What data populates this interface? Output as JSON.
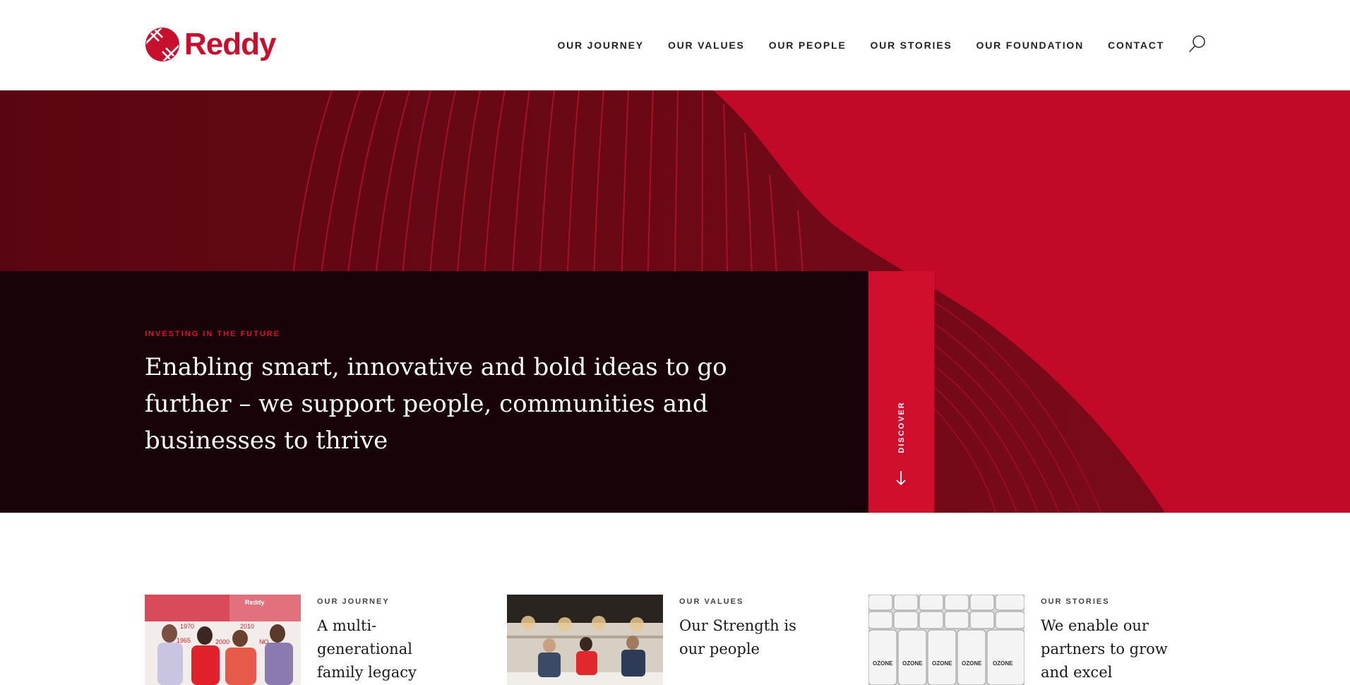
{
  "brand": {
    "name": "Reddy",
    "color": "#c8102e"
  },
  "nav": {
    "items": [
      {
        "label": "OUR JOURNEY"
      },
      {
        "label": "OUR VALUES"
      },
      {
        "label": "OUR PEOPLE"
      },
      {
        "label": "OUR STORIES"
      },
      {
        "label": "OUR FOUNDATION"
      },
      {
        "label": "CONTACT"
      }
    ],
    "search_icon": "search-icon"
  },
  "hero": {
    "kicker": "INVESTING IN THE FUTURE",
    "title": "Enabling smart, innovative and bold ideas to go further – we support people, communities and businesses to thrive",
    "discover_label": "DISCOVER",
    "colors": {
      "red": "#c20a28",
      "dark": "#170308",
      "accent": "#d00f2c"
    }
  },
  "cards": [
    {
      "kicker": "OUR JOURNEY",
      "title": "A multi-generational family legacy",
      "image": "family-photo"
    },
    {
      "kicker": "OUR VALUES",
      "title": "Our Strength is our people",
      "image": "meeting-photo"
    },
    {
      "kicker": "OUR STORIES",
      "title": "We enable our partners to grow and excel",
      "image": "coffee-bags-photo"
    }
  ]
}
